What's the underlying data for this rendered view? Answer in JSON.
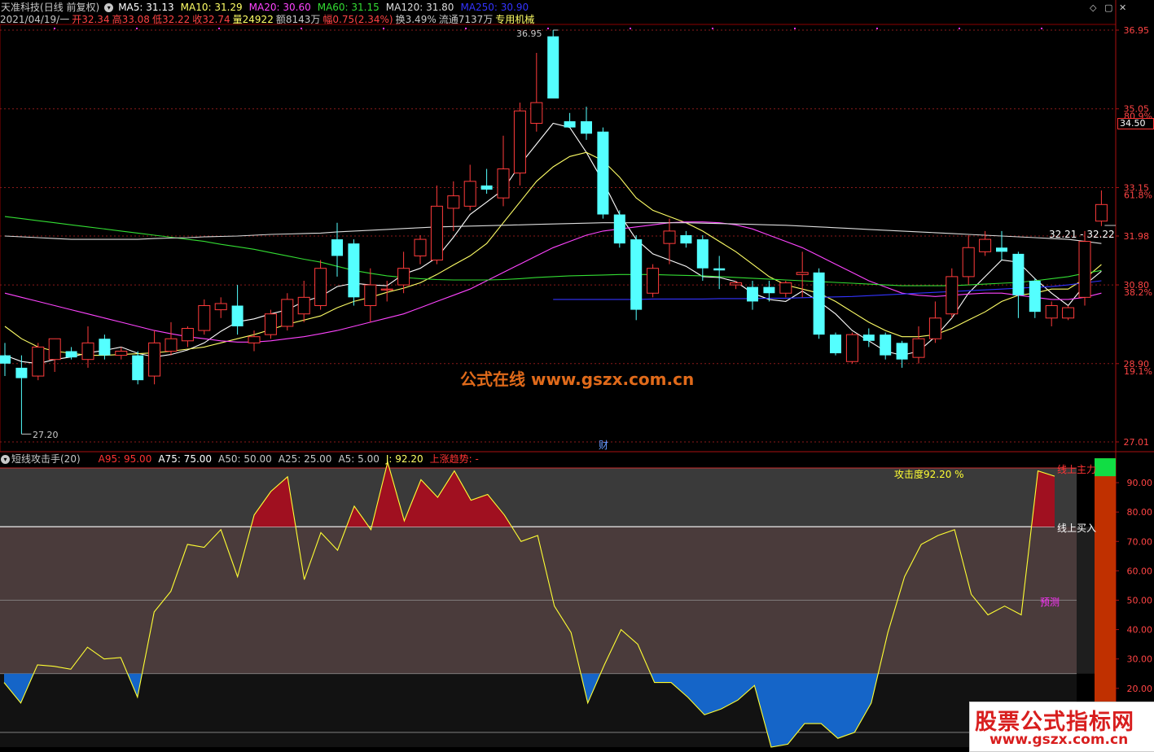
{
  "header": {
    "stock_name": "天准科技",
    "period": "(日线 前复权)",
    "ma_items": [
      {
        "label": "MA5: 31.13",
        "color": "#ffffff"
      },
      {
        "label": "MA10: 31.29",
        "color": "#ffff66"
      },
      {
        "label": "MA20: 30.60",
        "color": "#ff44ff"
      },
      {
        "label": "MA60: 31.15",
        "color": "#33dd33"
      },
      {
        "label": "MA120: 31.80",
        "color": "#dddddd"
      },
      {
        "label": "MA250: 30.90",
        "color": "#3333ff"
      }
    ],
    "info_items": [
      {
        "label": "2021/04/19/一",
        "color": "#c8c8c8"
      },
      {
        "label": "开32.34",
        "color": "#ff4444"
      },
      {
        "label": "高33.08",
        "color": "#ff4444"
      },
      {
        "label": "低32.22",
        "color": "#ff4444"
      },
      {
        "label": "收32.74",
        "color": "#ff4444"
      },
      {
        "label": "量24922",
        "color": "#ffff66"
      },
      {
        "label": "额8143万",
        "color": "#c8c8c8"
      },
      {
        "label": "幅0.75(2.34%)",
        "color": "#ff4444"
      },
      {
        "label": "换3.49%",
        "color": "#c8c8c8"
      },
      {
        "label": "流通7137万",
        "color": "#c8c8c8"
      },
      {
        "label": "专用机械",
        "color": "#ffff66"
      }
    ]
  },
  "price_axis": {
    "ticks": [
      "36.95",
      "35.05",
      "33.15",
      "31.98",
      "30.80",
      "28.90",
      "27.01"
    ],
    "pct_labels": [
      {
        "value": 35.05,
        "text": "80.9%"
      },
      {
        "value": 33.15,
        "text": "61.8%"
      },
      {
        "value": 30.8,
        "text": "38.2%"
      },
      {
        "value": 28.9,
        "text": "19.1%"
      }
    ],
    "current_box": "34.50",
    "range_label": "32.21 - 32.22",
    "high_label": "36.95",
    "low_label": "27.20",
    "cai_mark": "财"
  },
  "indicator": {
    "name": "短线攻击手(20)",
    "items": [
      {
        "label": "A95: 95.00",
        "color": "#ff3333"
      },
      {
        "label": "A75: 75.00",
        "color": "#ffffff"
      },
      {
        "label": "A50: 50.00",
        "color": "#c8c8c8"
      },
      {
        "label": "A25: 25.00",
        "color": "#c8c8c8"
      },
      {
        "label": "A5: 5.00",
        "color": "#c8c8c8"
      },
      {
        "label": "J: 92.20",
        "color": "#ffff66"
      },
      {
        "label": "上涨趋势: -",
        "color": "#ff3333"
      }
    ],
    "attack_text": "攻击度92.20 %",
    "buy_text": "线上买入",
    "main_force_text": "线上主力",
    "forecast_text": "预测",
    "axis_ticks": [
      "90.00",
      "80.00",
      "70.00",
      "60.00",
      "50.00",
      "40.00",
      "30.00",
      "20.00"
    ]
  },
  "watermarks": {
    "center": "公式在线 www.gszx.com.cn",
    "corner_title": "股票公式指标网",
    "corner_url": "www.gszx.com.cn"
  },
  "chart_data": [
    {
      "type": "candlestick",
      "title": "天准科技",
      "ylim": [
        27.01,
        36.95
      ],
      "candles": [
        {
          "o": 29.1,
          "h": 29.4,
          "l": 28.6,
          "c": 28.9
        },
        {
          "o": 28.8,
          "h": 29.1,
          "l": 27.2,
          "c": 28.55
        },
        {
          "o": 28.6,
          "h": 29.4,
          "l": 28.5,
          "c": 29.3
        },
        {
          "o": 29.0,
          "h": 29.5,
          "l": 28.7,
          "c": 29.5
        },
        {
          "o": 29.2,
          "h": 29.3,
          "l": 29.0,
          "c": 29.05
        },
        {
          "o": 29.0,
          "h": 29.8,
          "l": 28.8,
          "c": 29.4
        },
        {
          "o": 29.5,
          "h": 29.6,
          "l": 29.0,
          "c": 29.1
        },
        {
          "o": 29.1,
          "h": 29.3,
          "l": 29.0,
          "c": 29.2
        },
        {
          "o": 29.1,
          "h": 29.2,
          "l": 28.4,
          "c": 28.5
        },
        {
          "o": 28.6,
          "h": 29.7,
          "l": 28.4,
          "c": 29.4
        },
        {
          "o": 29.2,
          "h": 29.9,
          "l": 29.1,
          "c": 29.5
        },
        {
          "o": 29.45,
          "h": 29.8,
          "l": 29.3,
          "c": 29.75
        },
        {
          "o": 29.7,
          "h": 30.45,
          "l": 29.6,
          "c": 30.3
        },
        {
          "o": 30.2,
          "h": 30.5,
          "l": 30.0,
          "c": 30.35
        },
        {
          "o": 30.3,
          "h": 30.8,
          "l": 29.6,
          "c": 29.8
        },
        {
          "o": 29.4,
          "h": 29.7,
          "l": 29.2,
          "c": 29.55
        },
        {
          "o": 29.6,
          "h": 30.2,
          "l": 29.5,
          "c": 30.1
        },
        {
          "o": 29.8,
          "h": 30.6,
          "l": 29.7,
          "c": 30.45
        },
        {
          "o": 30.1,
          "h": 30.9,
          "l": 29.9,
          "c": 30.5
        },
        {
          "o": 30.3,
          "h": 31.4,
          "l": 30.2,
          "c": 31.2
        },
        {
          "o": 31.9,
          "h": 32.3,
          "l": 31.0,
          "c": 31.5
        },
        {
          "o": 31.8,
          "h": 31.9,
          "l": 30.3,
          "c": 30.5
        },
        {
          "o": 30.3,
          "h": 31.2,
          "l": 29.9,
          "c": 30.8
        },
        {
          "o": 30.7,
          "h": 30.9,
          "l": 30.4,
          "c": 30.7
        },
        {
          "o": 30.8,
          "h": 31.6,
          "l": 30.6,
          "c": 31.2
        },
        {
          "o": 31.5,
          "h": 32.0,
          "l": 31.3,
          "c": 31.9
        },
        {
          "o": 31.4,
          "h": 33.2,
          "l": 31.3,
          "c": 32.7
        },
        {
          "o": 32.65,
          "h": 33.3,
          "l": 32.1,
          "c": 32.95
        },
        {
          "o": 32.7,
          "h": 33.7,
          "l": 32.6,
          "c": 33.3
        },
        {
          "o": 33.2,
          "h": 33.6,
          "l": 33.0,
          "c": 33.1
        },
        {
          "o": 32.9,
          "h": 34.4,
          "l": 32.7,
          "c": 33.6
        },
        {
          "o": 33.5,
          "h": 35.2,
          "l": 33.2,
          "c": 35.0
        },
        {
          "o": 34.7,
          "h": 36.4,
          "l": 34.5,
          "c": 35.2
        },
        {
          "o": 36.8,
          "h": 36.95,
          "l": 35.3,
          "c": 35.3
        },
        {
          "o": 34.75,
          "h": 34.95,
          "l": 34.6,
          "c": 34.6
        },
        {
          "o": 34.75,
          "h": 35.1,
          "l": 34.3,
          "c": 34.45
        },
        {
          "o": 34.5,
          "h": 34.6,
          "l": 32.4,
          "c": 32.5
        },
        {
          "o": 32.5,
          "h": 32.6,
          "l": 31.7,
          "c": 31.8
        },
        {
          "o": 31.9,
          "h": 32.0,
          "l": 29.95,
          "c": 30.2
        },
        {
          "o": 30.6,
          "h": 31.3,
          "l": 30.5,
          "c": 31.2
        },
        {
          "o": 31.8,
          "h": 32.4,
          "l": 31.3,
          "c": 32.1
        },
        {
          "o": 32.0,
          "h": 32.1,
          "l": 31.7,
          "c": 31.8
        },
        {
          "o": 31.9,
          "h": 32.0,
          "l": 30.9,
          "c": 31.2
        },
        {
          "o": 31.2,
          "h": 31.5,
          "l": 30.7,
          "c": 31.15
        },
        {
          "o": 30.8,
          "h": 30.9,
          "l": 30.7,
          "c": 30.85
        },
        {
          "o": 30.75,
          "h": 30.9,
          "l": 30.2,
          "c": 30.4
        },
        {
          "o": 30.75,
          "h": 30.9,
          "l": 30.4,
          "c": 30.6
        },
        {
          "o": 30.6,
          "h": 30.9,
          "l": 30.5,
          "c": 30.85
        },
        {
          "o": 31.05,
          "h": 31.6,
          "l": 30.5,
          "c": 31.1
        },
        {
          "o": 31.1,
          "h": 31.2,
          "l": 29.5,
          "c": 29.6
        },
        {
          "o": 29.6,
          "h": 29.65,
          "l": 29.1,
          "c": 29.15
        },
        {
          "o": 28.95,
          "h": 29.65,
          "l": 28.9,
          "c": 29.6
        },
        {
          "o": 29.6,
          "h": 29.75,
          "l": 29.3,
          "c": 29.45
        },
        {
          "o": 29.6,
          "h": 29.65,
          "l": 29.0,
          "c": 29.1
        },
        {
          "o": 29.4,
          "h": 29.45,
          "l": 28.8,
          "c": 29.0
        },
        {
          "o": 29.05,
          "h": 29.8,
          "l": 28.9,
          "c": 29.5
        },
        {
          "o": 29.5,
          "h": 30.4,
          "l": 29.4,
          "c": 30.0
        },
        {
          "o": 30.1,
          "h": 31.2,
          "l": 30.0,
          "c": 31.0
        },
        {
          "o": 31.0,
          "h": 32.0,
          "l": 30.8,
          "c": 31.7
        },
        {
          "o": 31.6,
          "h": 32.1,
          "l": 31.5,
          "c": 31.9
        },
        {
          "o": 31.7,
          "h": 32.1,
          "l": 31.4,
          "c": 31.6
        },
        {
          "o": 31.55,
          "h": 31.6,
          "l": 30.0,
          "c": 30.55
        },
        {
          "o": 30.9,
          "h": 30.95,
          "l": 30.0,
          "c": 30.15
        },
        {
          "o": 30.0,
          "h": 30.4,
          "l": 29.8,
          "c": 30.3
        },
        {
          "o": 30.0,
          "h": 30.3,
          "l": 29.95,
          "c": 30.25
        },
        {
          "o": 30.5,
          "h": 32.1,
          "l": 30.3,
          "c": 31.85
        },
        {
          "o": 32.34,
          "h": 33.08,
          "l": 32.22,
          "c": 32.74
        }
      ],
      "series": [
        {
          "name": "MA5",
          "color": "#ffffff",
          "values": [
            29.1,
            28.95,
            28.9,
            29.0,
            29.06,
            29.16,
            29.22,
            29.3,
            29.15,
            29.06,
            29.12,
            29.23,
            29.4,
            29.68,
            29.91,
            29.98,
            30.1,
            30.2,
            30.4,
            30.52,
            30.76,
            30.84,
            30.8,
            30.78,
            31.06,
            31.2,
            31.46,
            31.95,
            32.5,
            32.8,
            33.1,
            33.7,
            34.2,
            34.7,
            34.6,
            34.0,
            33.3,
            32.5,
            31.9,
            31.55,
            31.4,
            31.25,
            31.0,
            30.98,
            30.88,
            30.6,
            30.45,
            30.4,
            30.65,
            30.4,
            30.1,
            29.7,
            29.45,
            29.2,
            29.1,
            29.2,
            29.55,
            30.0,
            30.6,
            31.0,
            31.4,
            31.35,
            30.95,
            30.6,
            30.3,
            30.8,
            31.13
          ]
        },
        {
          "name": "MA10",
          "color": "#ffff66",
          "values": [
            29.8,
            29.5,
            29.3,
            29.2,
            29.15,
            29.1,
            29.1,
            29.12,
            29.14,
            29.16,
            29.2,
            29.25,
            29.3,
            29.4,
            29.5,
            29.6,
            29.72,
            29.85,
            29.95,
            30.05,
            30.25,
            30.4,
            30.5,
            30.62,
            30.72,
            30.85,
            31.05,
            31.28,
            31.5,
            31.8,
            32.3,
            32.8,
            33.3,
            33.65,
            33.9,
            34.0,
            33.8,
            33.4,
            32.9,
            32.6,
            32.45,
            32.3,
            32.1,
            31.85,
            31.6,
            31.3,
            31.0,
            30.8,
            30.7,
            30.6,
            30.4,
            30.15,
            29.9,
            29.7,
            29.55,
            29.55,
            29.6,
            29.75,
            29.95,
            30.15,
            30.4,
            30.55,
            30.6,
            30.7,
            30.7,
            30.95,
            31.29
          ]
        },
        {
          "name": "MA20",
          "color": "#ff44ff",
          "values": [
            30.6,
            30.5,
            30.4,
            30.3,
            30.2,
            30.1,
            30.0,
            29.9,
            29.8,
            29.7,
            29.62,
            29.55,
            29.5,
            29.45,
            29.42,
            29.42,
            29.45,
            29.5,
            29.55,
            29.62,
            29.7,
            29.8,
            29.9,
            30.0,
            30.1,
            30.25,
            30.4,
            30.55,
            30.7,
            30.9,
            31.1,
            31.3,
            31.5,
            31.7,
            31.85,
            32.0,
            32.1,
            32.15,
            32.2,
            32.25,
            32.3,
            32.32,
            32.32,
            32.3,
            32.25,
            32.15,
            32.0,
            31.85,
            31.7,
            31.5,
            31.3,
            31.1,
            30.9,
            30.75,
            30.6,
            30.55,
            30.52,
            30.55,
            30.58,
            30.6,
            30.6,
            30.55,
            30.5,
            30.45,
            30.45,
            30.5,
            30.6
          ]
        },
        {
          "name": "MA60",
          "color": "#33dd33",
          "values": [
            32.45,
            32.4,
            32.35,
            32.3,
            32.25,
            32.2,
            32.15,
            32.1,
            32.05,
            32.0,
            31.95,
            31.9,
            31.85,
            31.78,
            31.72,
            31.66,
            31.58,
            31.5,
            31.42,
            31.35,
            31.25,
            31.15,
            31.08,
            31.02,
            30.98,
            30.95,
            30.93,
            30.92,
            30.92,
            30.92,
            30.93,
            30.95,
            30.98,
            31.0,
            31.02,
            31.03,
            31.04,
            31.05,
            31.05,
            31.05,
            31.04,
            31.03,
            31.02,
            31.0,
            30.98,
            30.96,
            30.94,
            30.92,
            30.9,
            30.88,
            30.86,
            30.84,
            30.82,
            30.8,
            30.78,
            30.78,
            30.78,
            30.78,
            30.8,
            30.82,
            30.84,
            30.86,
            30.9,
            30.95,
            31.0,
            31.08,
            31.15
          ]
        },
        {
          "name": "MA120",
          "color": "#dddddd",
          "values": [
            31.98,
            31.96,
            31.94,
            31.92,
            31.9,
            31.9,
            31.9,
            31.9,
            31.9,
            31.92,
            31.93,
            31.94,
            31.96,
            31.97,
            31.98,
            32.0,
            32.02,
            32.03,
            32.04,
            32.05,
            32.08,
            32.1,
            32.12,
            32.14,
            32.16,
            32.18,
            32.2,
            32.21,
            32.22,
            32.23,
            32.24,
            32.25,
            32.26,
            32.27,
            32.28,
            32.29,
            32.3,
            32.3,
            32.3,
            32.3,
            32.3,
            32.3,
            32.29,
            32.28,
            32.27,
            32.26,
            32.25,
            32.24,
            32.22,
            32.2,
            32.18,
            32.16,
            32.14,
            32.12,
            32.1,
            32.08,
            32.06,
            32.04,
            32.02,
            32.0,
            31.98,
            31.96,
            31.94,
            31.92,
            31.9,
            31.85,
            31.8
          ]
        },
        {
          "name": "MA250",
          "color": "#3333ff",
          "values": [
            null,
            null,
            null,
            null,
            null,
            null,
            null,
            null,
            null,
            null,
            null,
            null,
            null,
            null,
            null,
            null,
            null,
            null,
            null,
            null,
            null,
            null,
            null,
            null,
            null,
            null,
            null,
            null,
            null,
            null,
            null,
            null,
            null,
            30.45,
            30.45,
            30.45,
            30.45,
            30.45,
            30.45,
            30.46,
            30.46,
            30.46,
            30.46,
            30.47,
            30.47,
            30.47,
            30.48,
            30.48,
            30.49,
            30.5,
            30.51,
            30.52,
            30.54,
            30.56,
            30.58,
            30.6,
            30.62,
            30.64,
            30.66,
            30.68,
            30.7,
            30.72,
            30.74,
            30.76,
            30.8,
            30.85,
            30.9
          ]
        }
      ]
    },
    {
      "type": "area",
      "title": "短线攻击手(20)",
      "ylim": [
        0,
        100
      ],
      "reference_lines": [
        95,
        75,
        50,
        25,
        5
      ],
      "J": [
        22,
        15,
        28,
        27.5,
        26.5,
        34,
        30,
        30.5,
        17,
        46,
        53,
        69,
        68,
        74,
        58,
        79,
        87,
        92,
        57,
        73,
        67,
        82,
        74,
        97,
        77,
        91,
        85,
        94,
        84,
        86,
        79,
        70,
        72,
        48,
        39,
        15,
        28,
        40,
        35,
        22,
        22,
        17,
        11,
        13,
        16,
        21,
        0,
        1,
        8,
        8,
        3,
        5,
        15,
        39,
        58,
        69,
        72,
        74,
        52,
        45,
        48,
        45,
        94,
        92.2
      ],
      "bar_J": 92.2
    }
  ]
}
